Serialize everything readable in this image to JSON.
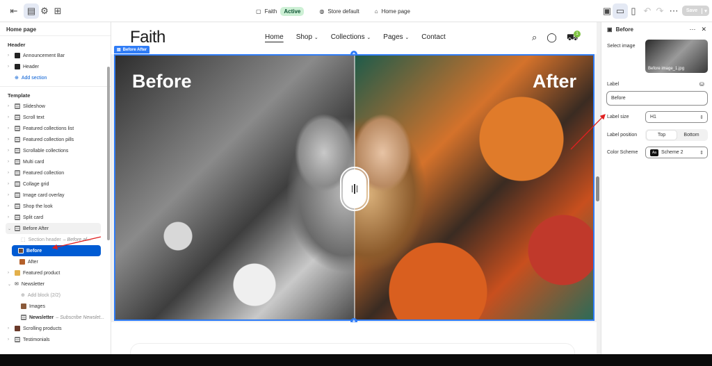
{
  "topbar": {
    "store": "Faith",
    "status": "Active",
    "theme": "Store default",
    "page": "Home page",
    "save": "Save"
  },
  "sidebar": {
    "title": "Home page",
    "header_group": "Header",
    "header_items": [
      "Announcement Bar",
      "Header"
    ],
    "add_section": "Add section",
    "template_group": "Template",
    "template_items": [
      "Slideshow",
      "Scroll text",
      "Featured collections list",
      "Featured collection pills",
      "Scrollable collections",
      "Multi card",
      "Featured collection",
      "Collage grid",
      "Image card overlay",
      "Shop the look",
      "Split card",
      "Before After"
    ],
    "section_header": "Section header",
    "section_header_sub": "– Before af...",
    "before": "Before",
    "after": "After",
    "featured_product": "Featured product",
    "newsletter": "Newsletter",
    "add_block": "Add block (2/2)",
    "images": "Images",
    "newsletter_block": "Newsletter",
    "newsletter_block_sub": "– Subscribe Newslet...",
    "scrolling_products": "Scrolling products",
    "testimonials": "Testimonials"
  },
  "store": {
    "logo": "Faith",
    "nav": [
      "Home",
      "Shop",
      "Collections",
      "Pages",
      "Contact"
    ],
    "cart_count": "1",
    "section_tag": "Before After",
    "label_before": "Before",
    "label_after": "After"
  },
  "panel": {
    "title": "Before",
    "select_image": "Select image",
    "image_name": "Before image_1.jpg",
    "label": "Label",
    "label_value": "Before",
    "label_size": "Label size",
    "label_size_value": "H1",
    "label_position": "Label position",
    "pos_top": "Top",
    "pos_bottom": "Bottom",
    "color_scheme": "Color Scheme",
    "swatch": "Aa",
    "color_scheme_value": "Scheme 2"
  },
  "colors": {
    "accent": "#2f7cf6",
    "selected": "#005bd3",
    "active_badge": "#cdf0d5",
    "annotation": "#e02020"
  }
}
